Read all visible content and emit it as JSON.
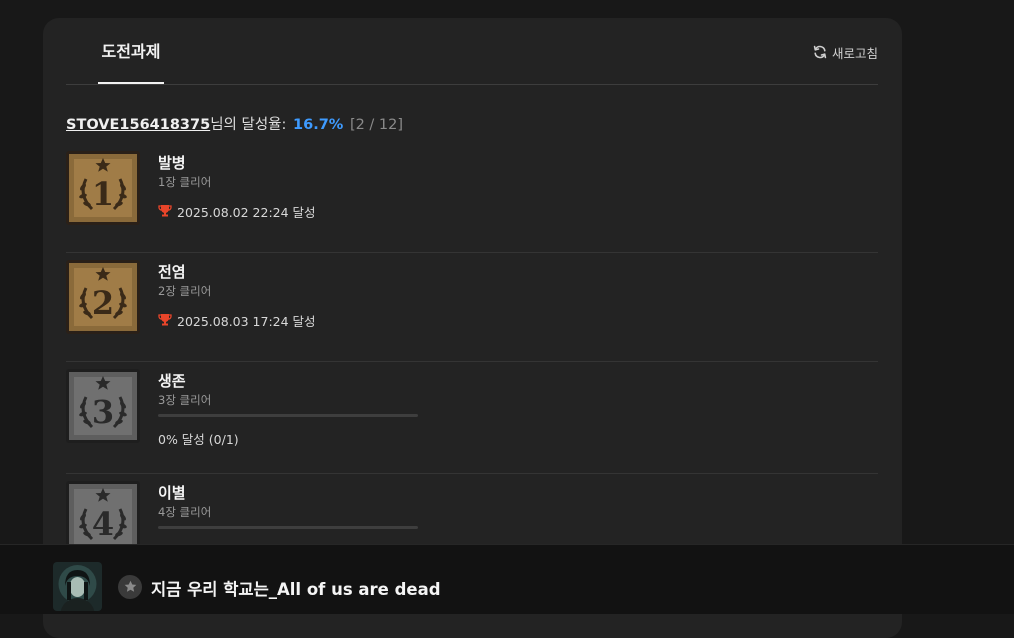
{
  "tabs": [
    {
      "label": "도전과제",
      "active": true
    }
  ],
  "refresh_label": "새로고침",
  "rate": {
    "user": "STOVE156418375",
    "suffix": "님의 달성율:",
    "percent": "16.7%",
    "count": "[2 / 12]"
  },
  "achievements": [
    {
      "number": "1",
      "name": "발병",
      "desc": "1장 클리어",
      "unlocked": true,
      "achieved_at": "2025.08.02 22:24 달성"
    },
    {
      "number": "2",
      "name": "전염",
      "desc": "2장 클리어",
      "unlocked": true,
      "achieved_at": "2025.08.03 17:24 달성"
    },
    {
      "number": "3",
      "name": "생존",
      "desc": "3장 클리어",
      "unlocked": false,
      "progress": 0,
      "progress_text": "0% 달성 (0/1)"
    },
    {
      "number": "4",
      "name": "이별",
      "desc": "4장 클리어",
      "unlocked": false,
      "progress": 0
    }
  ],
  "game": {
    "title": "지금 우리 학교는_All of us are dead"
  },
  "colors": {
    "accent": "#3e9bff",
    "trophy": "#e8452a",
    "badge_gold": "#8a6a3a",
    "badge_gray": "#6a6a6a"
  },
  "icons": {
    "refresh": "refresh-icon",
    "trophy": "trophy-icon",
    "star": "star-icon"
  }
}
